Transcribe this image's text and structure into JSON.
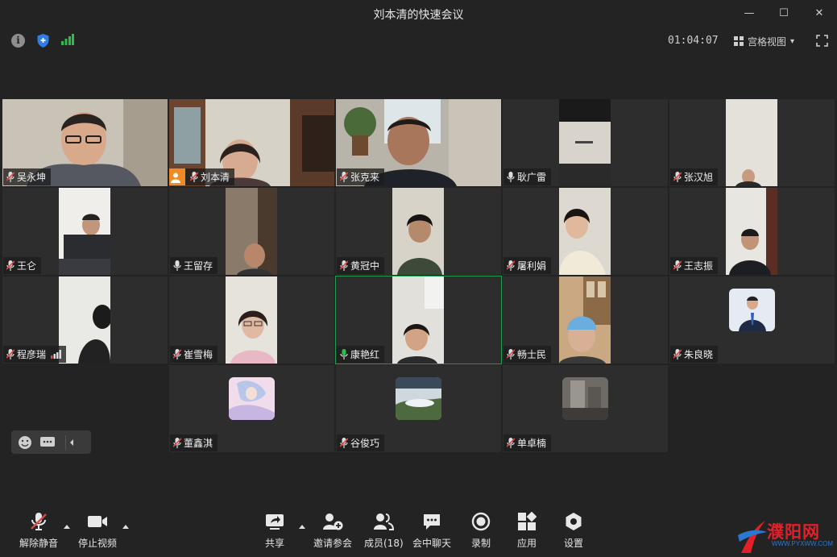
{
  "window": {
    "title": "刘本清的快速会议",
    "minimize_glyph": "—",
    "maximize_glyph": "☐",
    "close_glyph": "✕"
  },
  "status_bar": {
    "info_glyph": "i",
    "timer": "01:04:07",
    "view_mode": "宫格视图",
    "view_caret": "▾",
    "signal_color": "#27c14a",
    "shield_color": "#2f7bea"
  },
  "participants": [
    {
      "name": "吴永坤",
      "mic": "muted"
    },
    {
      "name": "刘本清",
      "mic": "muted",
      "host": true
    },
    {
      "name": "张克来",
      "mic": "muted"
    },
    {
      "name": "耿广雷",
      "mic": "on"
    },
    {
      "name": "张汉旭",
      "mic": "muted"
    },
    {
      "name": "王仑",
      "mic": "muted"
    },
    {
      "name": "王留存",
      "mic": "on"
    },
    {
      "name": "黄冠中",
      "mic": "muted"
    },
    {
      "name": "屠利娟",
      "mic": "muted"
    },
    {
      "name": "王志振",
      "mic": "muted"
    },
    {
      "name": "程彦瑞",
      "mic": "muted",
      "weak_signal": true
    },
    {
      "name": "崔雪梅",
      "mic": "muted"
    },
    {
      "name": "康艳红",
      "mic": "speaking",
      "active": true
    },
    {
      "name": "畅士民",
      "mic": "muted"
    },
    {
      "name": "朱良晓",
      "mic": "muted",
      "video": "off"
    },
    {
      "name": "董鑫淇",
      "mic": "muted",
      "video": "off"
    },
    {
      "name": "谷俊巧",
      "mic": "muted",
      "video": "off"
    },
    {
      "name": "单卓楠",
      "mic": "muted",
      "video": "off"
    }
  ],
  "toolbar": {
    "unmute": "解除静音",
    "stop_video": "停止视频",
    "share": "共享",
    "invite": "邀请参会",
    "members": "成员(18)",
    "chat": "会中聊天",
    "record": "录制",
    "apps": "应用",
    "settings": "设置"
  },
  "watermark": {
    "text": "濮阳网",
    "url": "WWW.PYXWW.COM"
  },
  "colors": {
    "background": "#232323",
    "tile": "#2d2d2d",
    "active_border": "#1e9e4f",
    "muted_red": "#e04848",
    "host_orange": "#f08a24"
  }
}
